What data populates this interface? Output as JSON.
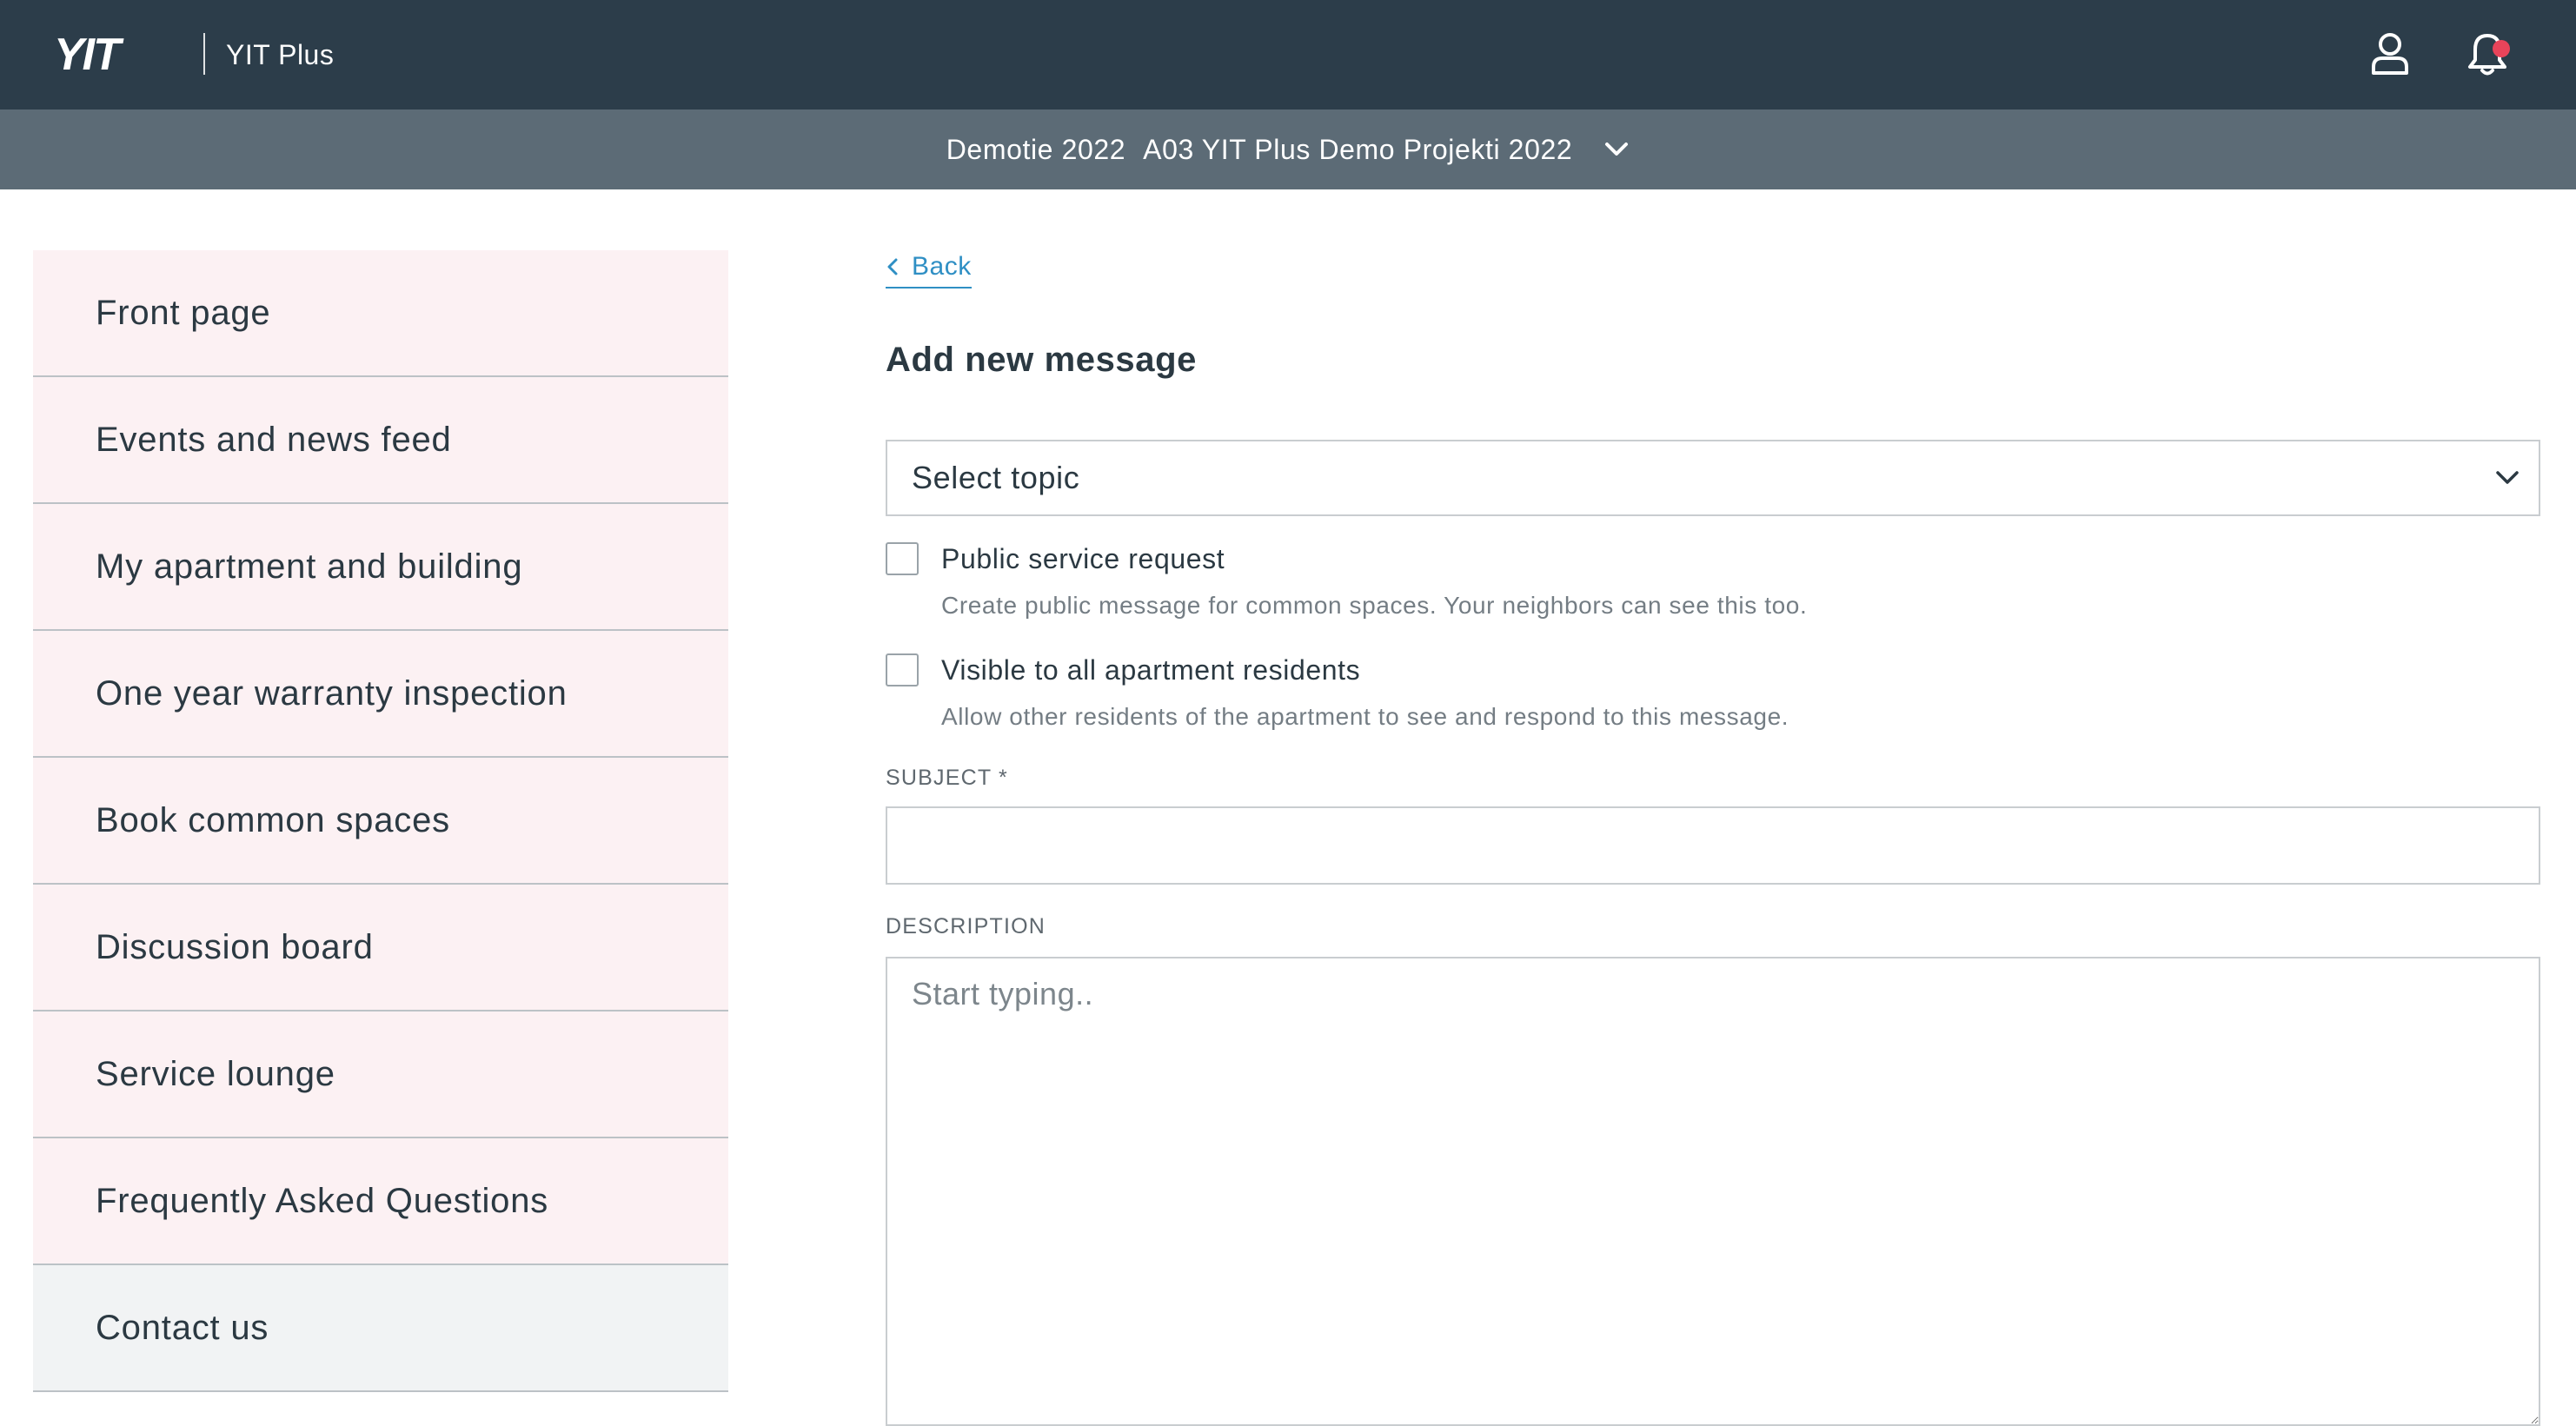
{
  "header": {
    "logo_text": "YIT",
    "app_name": "YIT Plus",
    "icons": {
      "user": "user-icon",
      "notifications": "bell-icon"
    },
    "accent_color": "#2c3d4a",
    "notification_dot_color": "#e8445a"
  },
  "project_selector": {
    "code": "Demotie 2022",
    "name": "A03 YIT Plus Demo Projekti 2022"
  },
  "sidebar": {
    "items": [
      {
        "label": "Front page"
      },
      {
        "label": "Events and news feed"
      },
      {
        "label": "My apartment and building"
      },
      {
        "label": "One year warranty inspection"
      },
      {
        "label": "Book common spaces"
      },
      {
        "label": "Discussion board"
      },
      {
        "label": "Service lounge"
      },
      {
        "label": "Frequently Asked Questions"
      },
      {
        "label": "Contact us"
      }
    ],
    "active": "Contact us"
  },
  "form": {
    "back_label": "Back",
    "title": "Add new message",
    "topic_select": {
      "selected": "Select topic"
    },
    "public_request": {
      "label": "Public service request",
      "help": "Create public message for common spaces. Your neighbors can see this too."
    },
    "visible_to_residents": {
      "label": "Visible to all apartment residents",
      "help": "Allow other residents of the apartment to see and respond to this message."
    },
    "subject": {
      "label": "SUBJECT *",
      "value": ""
    },
    "description": {
      "label": "DESCRIPTION",
      "placeholder": "Start typing.."
    }
  }
}
